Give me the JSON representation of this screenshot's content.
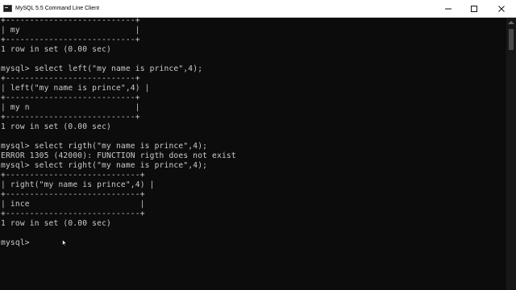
{
  "window": {
    "title": "MySQL 5.5 Command Line Client",
    "minimize_label": "—",
    "maximize_label": "□",
    "close_label": "✕"
  },
  "console": {
    "lines": [
      "+---------------------------+",
      "| my                        |",
      "+---------------------------+",
      "1 row in set (0.00 sec)",
      "",
      "mysql> select left(\"my name is prince\",4);",
      "+---------------------------+",
      "| left(\"my name is prince\",4) |",
      "+---------------------------+",
      "| my n                      |",
      "+---------------------------+",
      "1 row in set (0.00 sec)",
      "",
      "mysql> select rigth(\"my name is prince\",4);",
      "ERROR 1305 (42000): FUNCTION rigth does not exist",
      "mysql> select right(\"my name is prince\",4);",
      "+----------------------------+",
      "| right(\"my name is prince\",4) |",
      "+----------------------------+",
      "| ince                       |",
      "+----------------------------+",
      "1 row in set (0.00 sec)",
      "",
      "mysql>"
    ]
  },
  "icons": {
    "app": "console-app-icon",
    "minimize": "minimize-icon",
    "maximize": "maximize-icon",
    "close": "close-icon",
    "cursor": "mouse-pointer-icon"
  },
  "colors": {
    "background": "#0c0c0c",
    "text": "#cccccc",
    "titlebar": "#ffffff"
  }
}
